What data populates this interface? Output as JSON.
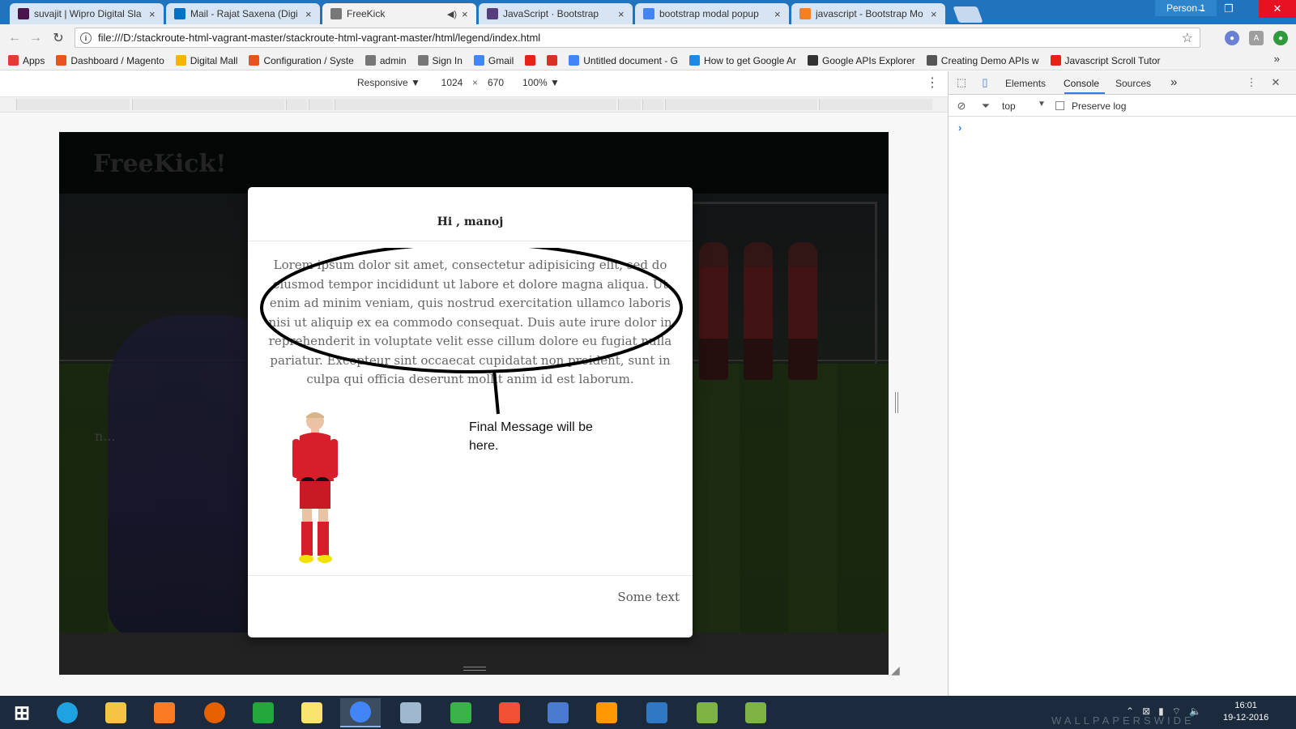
{
  "browser": {
    "tabs": [
      {
        "title": "suvajit | Wipro Digital Sla",
        "icon": "slack-icon",
        "color": "#4a154b",
        "active": false
      },
      {
        "title": "Mail - Rajat Saxena (Digi",
        "icon": "mail-icon",
        "color": "#0072c6",
        "active": false
      },
      {
        "title": "FreeKick",
        "icon": "page-icon",
        "color": "#777777",
        "active": true
      },
      {
        "title": "JavaScript · Bootstrap",
        "icon": "bootstrap-icon",
        "color": "#563d7c",
        "active": false
      },
      {
        "title": "bootstrap modal popup",
        "icon": "google-icon",
        "color": "#4285f4",
        "active": false
      },
      {
        "title": "javascript - Bootstrap Mo",
        "icon": "stackoverflow-icon",
        "color": "#f48024",
        "active": false
      }
    ],
    "profile": "Person 1",
    "window_controls": {
      "minimize": "–",
      "restore": "❐",
      "close": "✕"
    },
    "url": "file:///D:/stackroute-html-vagrant-master/stackroute-html-vagrant-master/html/legend/index.html",
    "bookmarks": [
      {
        "label": "Apps",
        "icon": "apps-grid-icon",
        "color": "#e53935"
      },
      {
        "label": "Dashboard / Magento",
        "icon": "magento-icon",
        "color": "#e8541c"
      },
      {
        "label": "Digital Mall",
        "icon": "drive-icon",
        "color": "#f4b400"
      },
      {
        "label": "Configuration / Syste",
        "icon": "magento-icon",
        "color": "#e8541c"
      },
      {
        "label": "admin",
        "icon": "page-icon",
        "color": "#777777"
      },
      {
        "label": "Sign In",
        "icon": "page-icon",
        "color": "#777777"
      },
      {
        "label": "Gmail",
        "icon": "google-icon",
        "color": "#4285f4"
      },
      {
        "label": "",
        "icon": "youtube-icon",
        "color": "#e62117"
      },
      {
        "label": "",
        "icon": "gmail-icon",
        "color": "#d93025"
      },
      {
        "label": "Untitled document - G",
        "icon": "google-icon",
        "color": "#4285f4"
      },
      {
        "label": "How to get Google Ar",
        "icon": "rs-icon",
        "color": "#1e88e5"
      },
      {
        "label": "Google APIs Explorer",
        "icon": "api-icon",
        "color": "#333333"
      },
      {
        "label": "Creating Demo APIs w",
        "icon": "globe-icon",
        "color": "#555555"
      },
      {
        "label": "Javascript Scroll Tutor",
        "icon": "youtube-icon",
        "color": "#e62117"
      }
    ]
  },
  "device_toolbar": {
    "mode": "Responsive ▼",
    "width": "1024",
    "height": "670",
    "times": "×",
    "zoom": "100% ▼"
  },
  "site": {
    "logo": "FreeKick!",
    "hero_caption": "n..."
  },
  "modal": {
    "title": "Hi , manoj",
    "body": "Lorem ipsum dolor sit amet, consectetur adipisicing elit, sed do eiusmod tempor incididunt ut labore et dolore magna aliqua. Ut enim ad minim veniam, quis nostrud exercitation ullamco laboris nisi ut aliquip ex ea commodo consequat. Duis aute irure dolor in reprehenderit in voluptate velit esse cillum dolore eu fugiat nulla pariatur. Excepteur sint occaecat cupidatat non proident, sunt in culpa qui officia deserunt mollit anim id est laborum.",
    "annotation": "Final Message will be here.",
    "footer": "Some text"
  },
  "devtools": {
    "tabs": [
      "Elements",
      "Console",
      "Sources"
    ],
    "active_tab": "Console",
    "more": "»",
    "context": "top",
    "preserve_log": "Preserve log",
    "prompt": "›",
    "accent": "#3879d9"
  },
  "taskbar": {
    "apps": [
      {
        "name": "windows-start-icon",
        "color": "#ffffff"
      },
      {
        "name": "internet-explorer-icon",
        "color": "#1ea2e1"
      },
      {
        "name": "file-explorer-icon",
        "color": "#f6c342"
      },
      {
        "name": "xampp-icon",
        "color": "#fb7a24"
      },
      {
        "name": "firefox-icon",
        "color": "#e66000"
      },
      {
        "name": "store-icon",
        "color": "#22a83a"
      },
      {
        "name": "sticky-notes-icon",
        "color": "#f8e36c"
      },
      {
        "name": "chrome-icon",
        "color": "#4285f4"
      },
      {
        "name": "paint-icon",
        "color": "#9fb8d0"
      },
      {
        "name": "task-manager-icon",
        "color": "#3bb14a"
      },
      {
        "name": "git-icon",
        "color": "#f05033"
      },
      {
        "name": "network-icon",
        "color": "#4a7bd0"
      },
      {
        "name": "sublime-icon",
        "color": "#ff9800"
      },
      {
        "name": "file-copy-icon",
        "color": "#2f78c4"
      },
      {
        "name": "lambda-icon",
        "color": "#7cb342"
      },
      {
        "name": "lambda-alt-icon",
        "color": "#7cb342"
      }
    ],
    "time": "16:01",
    "date": "19-12-2016",
    "watermark": "WALLPAPERSWIDE"
  }
}
